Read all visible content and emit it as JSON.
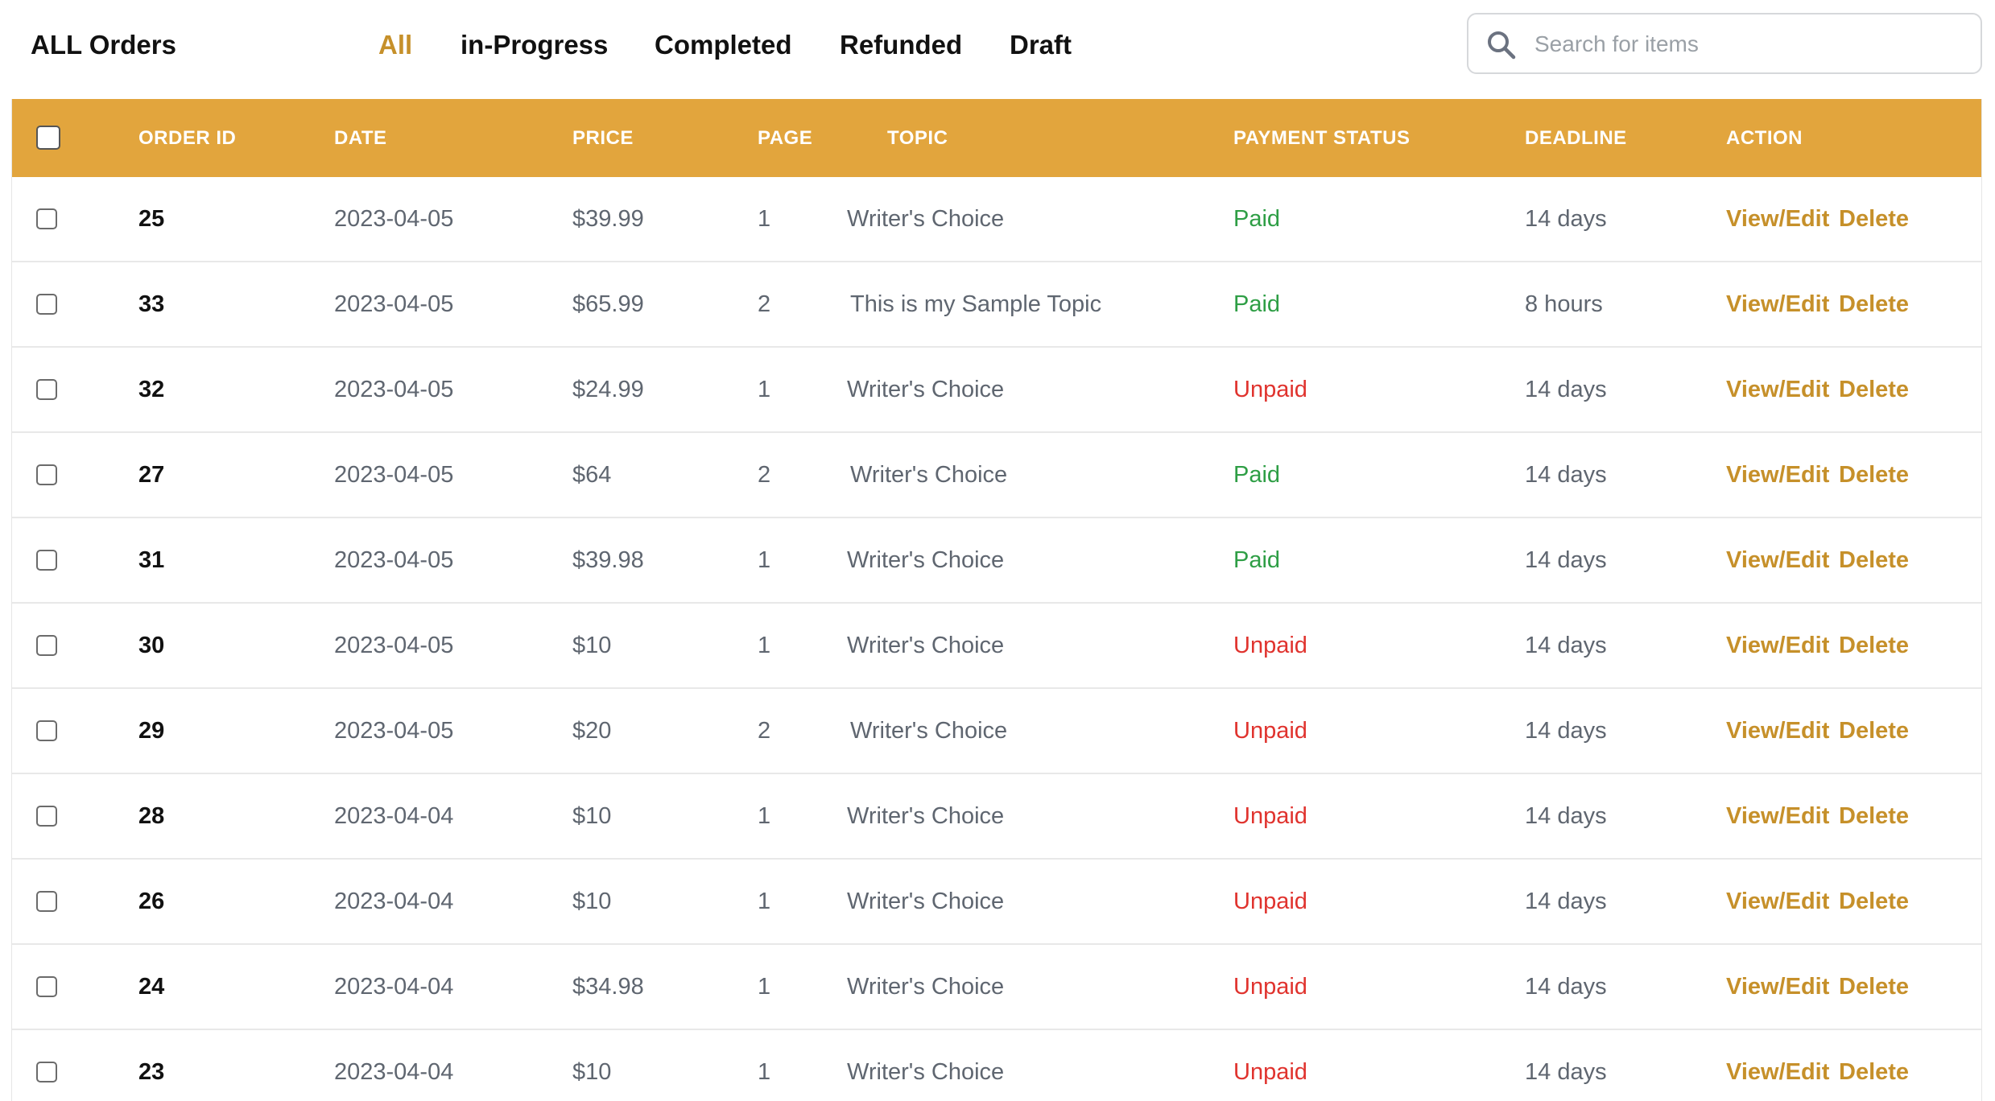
{
  "header": {
    "title": "ALL Orders",
    "tabs": [
      {
        "label": "All",
        "active": true
      },
      {
        "label": "in-Progress",
        "active": false
      },
      {
        "label": "Completed",
        "active": false
      },
      {
        "label": "Refunded",
        "active": false
      },
      {
        "label": "Draft",
        "active": false
      }
    ],
    "search": {
      "placeholder": "Search for items",
      "value": "",
      "icon": "search-icon"
    }
  },
  "colors": {
    "accent": "#C6902A",
    "header_bg": "#E2A53D",
    "paid": "#2E9E45",
    "unpaid": "#E0332E"
  },
  "table": {
    "columns": [
      "ORDER ID",
      "DATE",
      "PRICE",
      "PAGE",
      "TOPIC",
      "PAYMENT STATUS",
      "DEADLINE",
      "ACTION"
    ],
    "action_labels": {
      "edit": "View/Edit",
      "delete": "Delete"
    },
    "rows": [
      {
        "id": "25",
        "date": "2023-04-05",
        "price": "$39.99",
        "page": "1",
        "topic": "Writer's Choice",
        "payment": "Paid",
        "deadline": "14 days"
      },
      {
        "id": "33",
        "date": "2023-04-05",
        "price": "$65.99",
        "page": "2",
        "topic": "This is my Sample Topic",
        "payment": "Paid",
        "deadline": "8 hours"
      },
      {
        "id": "32",
        "date": "2023-04-05",
        "price": "$24.99",
        "page": "1",
        "topic": "Writer's Choice",
        "payment": "Unpaid",
        "deadline": "14 days"
      },
      {
        "id": "27",
        "date": "2023-04-05",
        "price": "$64",
        "page": "2",
        "topic": "Writer's Choice",
        "payment": "Paid",
        "deadline": "14 days"
      },
      {
        "id": "31",
        "date": "2023-04-05",
        "price": "$39.98",
        "page": "1",
        "topic": "Writer's Choice",
        "payment": "Paid",
        "deadline": "14 days"
      },
      {
        "id": "30",
        "date": "2023-04-05",
        "price": "$10",
        "page": "1",
        "topic": "Writer's Choice",
        "payment": "Unpaid",
        "deadline": "14 days"
      },
      {
        "id": "29",
        "date": "2023-04-05",
        "price": "$20",
        "page": "2",
        "topic": "Writer's Choice",
        "payment": "Unpaid",
        "deadline": "14 days"
      },
      {
        "id": "28",
        "date": "2023-04-04",
        "price": "$10",
        "page": "1",
        "topic": "Writer's Choice",
        "payment": "Unpaid",
        "deadline": "14 days"
      },
      {
        "id": "26",
        "date": "2023-04-04",
        "price": "$10",
        "page": "1",
        "topic": "Writer's Choice",
        "payment": "Unpaid",
        "deadline": "14 days"
      },
      {
        "id": "24",
        "date": "2023-04-04",
        "price": "$34.98",
        "page": "1",
        "topic": "Writer's Choice",
        "payment": "Unpaid",
        "deadline": "14 days"
      },
      {
        "id": "23",
        "date": "2023-04-04",
        "price": "$10",
        "page": "1",
        "topic": "Writer's Choice",
        "payment": "Unpaid",
        "deadline": "14 days"
      }
    ]
  }
}
